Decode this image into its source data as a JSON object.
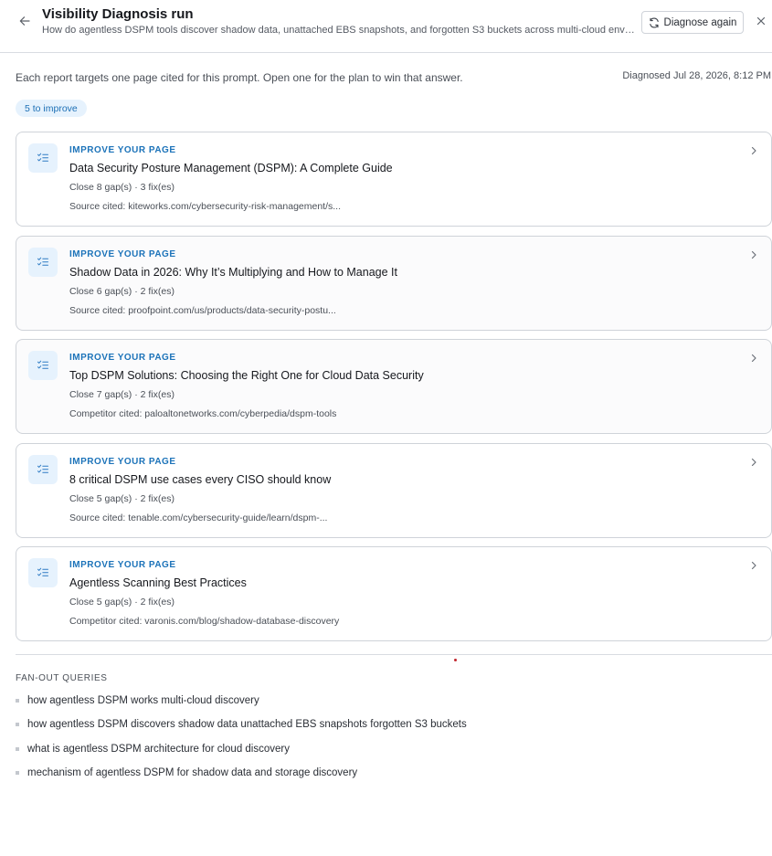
{
  "header": {
    "title": "Visibility Diagnosis run",
    "subtitle": "How do agentless DSPM tools discover shadow data, unattached EBS snapshots, and forgotten S3 buckets across multi-cloud environ...",
    "diagnose_again_label": "Diagnose again",
    "back_icon": "arrow-left-icon",
    "close_icon": "close-icon",
    "refresh_icon": "refresh-icon"
  },
  "summary": {
    "intro": "Each report targets one page cited for this prompt. Open one for the plan to win that answer.",
    "diagnosed_at": "Diagnosed Jul 28, 2026, 8:12 PM",
    "improve_badge": "5 to improve"
  },
  "cards": [
    {
      "kicker": "IMPROVE YOUR PAGE",
      "title": "Data Security Posture Management (DSPM): A Complete Guide",
      "gaps": "Close 8 gap(s) · 3 fix(es)",
      "source": "Source cited: kiteworks.com/cybersecurity-risk-management/s..."
    },
    {
      "kicker": "IMPROVE YOUR PAGE",
      "title": "Shadow Data in 2026: Why It’s Multiplying and How to Manage It",
      "gaps": "Close 6 gap(s) · 2 fix(es)",
      "source": "Source cited: proofpoint.com/us/products/data-security-postu..."
    },
    {
      "kicker": "IMPROVE YOUR PAGE",
      "title": "Top DSPM Solutions: Choosing the Right One for Cloud Data Security",
      "gaps": "Close 7 gap(s) · 2 fix(es)",
      "source": "Competitor cited: paloaltonetworks.com/cyberpedia/dspm-tools"
    },
    {
      "kicker": "IMPROVE YOUR PAGE",
      "title": "8 critical DSPM use cases every CISO should know",
      "gaps": "Close 5 gap(s) · 2 fix(es)",
      "source": "Source cited: tenable.com/cybersecurity-guide/learn/dspm-..."
    },
    {
      "kicker": "IMPROVE YOUR PAGE",
      "title": "Agentless Scanning Best Practices",
      "gaps": "Close 5 gap(s) · 2 fix(es)",
      "source": "Competitor cited: varonis.com/blog/shadow-database-discovery"
    }
  ],
  "fanout": {
    "heading": "FAN-OUT QUERIES",
    "items": [
      "how agentless DSPM works multi-cloud discovery",
      "how agentless DSPM discovers shadow data unattached EBS snapshots forgotten S3 buckets",
      "what is agentless DSPM architecture for cloud discovery",
      "mechanism of agentless DSPM for shadow data and storage discovery"
    ]
  },
  "colors": {
    "accent": "#1c73b9",
    "badge_bg": "#e6f2fd",
    "border": "#cfd3d9"
  }
}
